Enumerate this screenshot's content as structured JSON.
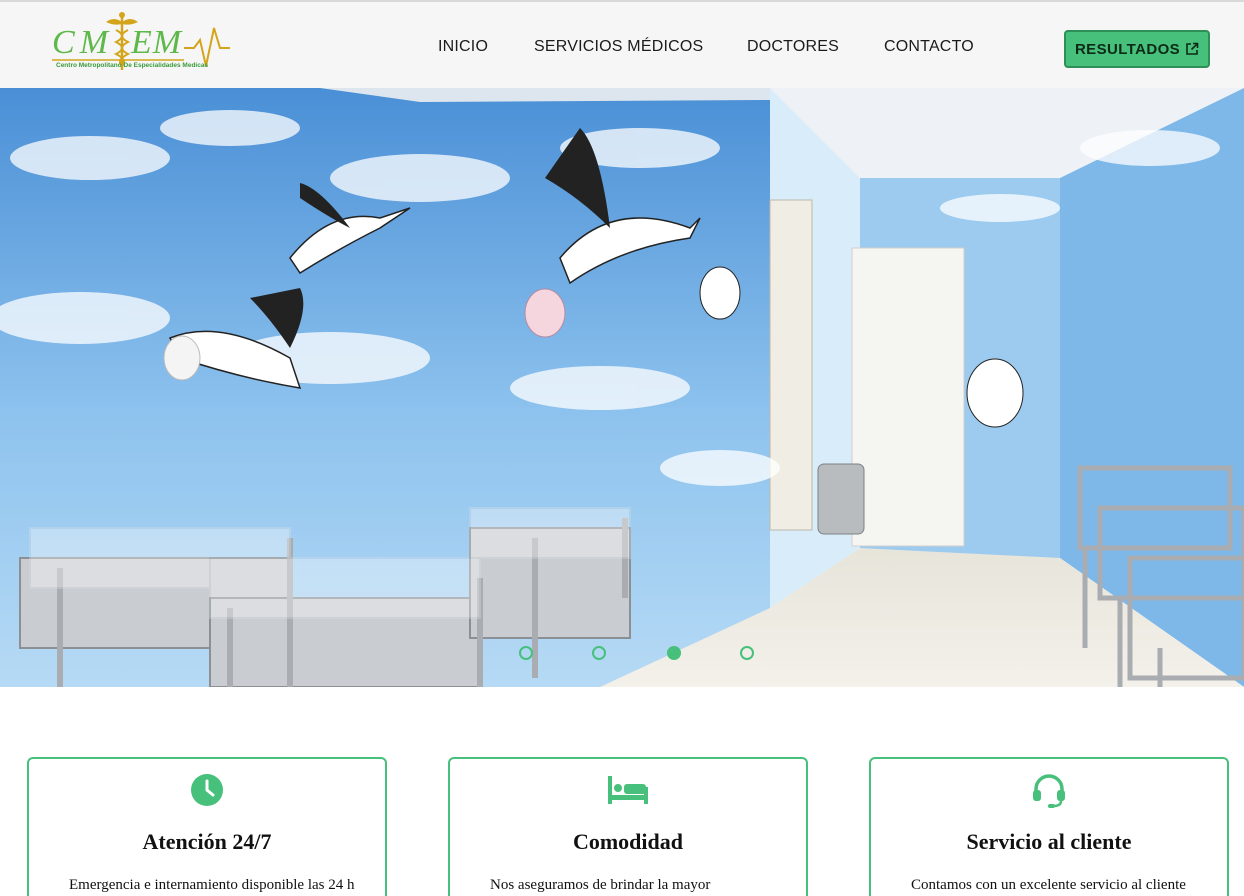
{
  "brand": {
    "logo_text": "CMEM",
    "logo_subtitle": "Centro Metropolitano De Especialidades Medicas",
    "icon": "caduceus-icon",
    "colors": {
      "green": "#46c07a",
      "logo_green": "#5fb84a",
      "logo_gold": "#d4a51c"
    }
  },
  "nav": {
    "items": [
      {
        "label": "INICIO"
      },
      {
        "label": "SERVICIOS MÉDICOS"
      },
      {
        "label": "DOCTORES"
      },
      {
        "label": "CONTACTO"
      }
    ],
    "cta_label": "RESULTADOS",
    "cta_icon": "external-link-icon"
  },
  "carousel": {
    "slide_count": 4,
    "active_index": 3
  },
  "features": [
    {
      "icon": "clock-icon",
      "title": "Atención 24/7",
      "text": "Emergencia e internamiento disponible las 24 h"
    },
    {
      "icon": "bed-icon",
      "title": "Comodidad",
      "text": "Nos aseguramos de brindar la mayor comodidad"
    },
    {
      "icon": "headset-icon",
      "title": "Servicio al cliente",
      "text": "Contamos con un excelente servicio al cliente"
    }
  ]
}
